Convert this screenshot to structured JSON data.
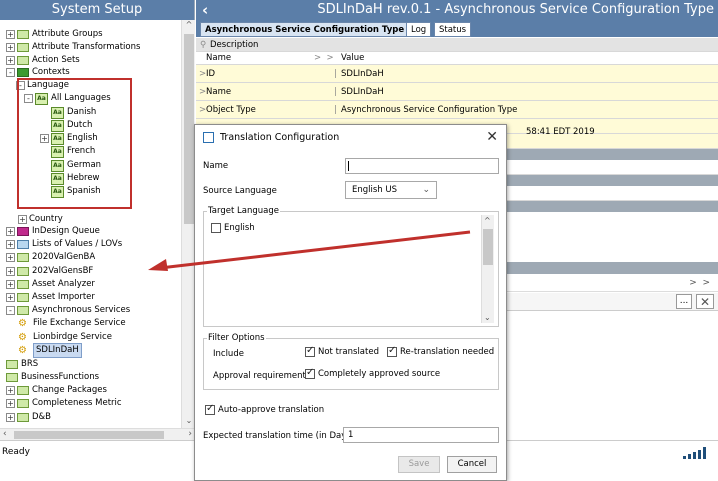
{
  "left_panel": {
    "title": "System Setup",
    "tree": [
      {
        "label": "Attribute Groups",
        "exp": "+",
        "icon": "folder"
      },
      {
        "label": "Attribute Transformations",
        "exp": "+",
        "icon": "folder"
      },
      {
        "label": "Action Sets",
        "exp": "+",
        "icon": "folder"
      },
      {
        "label": "Contexts",
        "exp": "-",
        "icon": "folder-green"
      },
      {
        "label": "Language",
        "exp": "-",
        "icon": "none"
      },
      {
        "label": "All Languages",
        "exp": "-",
        "icon": "language"
      },
      {
        "label": "Danish",
        "exp": "",
        "icon": "language"
      },
      {
        "label": "Dutch",
        "exp": "",
        "icon": "language"
      },
      {
        "label": "English",
        "exp": "+",
        "icon": "language"
      },
      {
        "label": "French",
        "exp": "",
        "icon": "language"
      },
      {
        "label": "German",
        "exp": "",
        "icon": "language"
      },
      {
        "label": "Hebrew",
        "exp": "",
        "icon": "language"
      },
      {
        "label": "Spanish",
        "exp": "",
        "icon": "language"
      },
      {
        "label": "Country",
        "exp": "+",
        "icon": "none"
      },
      {
        "label": "InDesign Queue",
        "exp": "+",
        "icon": "indesign"
      },
      {
        "label": "Lists of Values / LOVs",
        "exp": "+",
        "icon": "lov"
      },
      {
        "label": "2020ValGenBA",
        "exp": "+",
        "icon": "folder"
      },
      {
        "label": "202ValGensBF",
        "exp": "+",
        "icon": "folder"
      },
      {
        "label": "Asset Analyzer",
        "exp": "+",
        "icon": "folder"
      },
      {
        "label": "Asset Importer",
        "exp": "+",
        "icon": "folder"
      },
      {
        "label": "Asynchronous Services",
        "exp": "-",
        "icon": "folder"
      },
      {
        "label": "File Exchange Service",
        "exp": "",
        "icon": "gear"
      },
      {
        "label": "Lionbirdge Service",
        "exp": "",
        "icon": "gear"
      },
      {
        "label": "SDLInDaH",
        "exp": "",
        "icon": "gear"
      },
      {
        "label": "BRS",
        "exp": "",
        "icon": "folder"
      },
      {
        "label": "BusinessFunctions",
        "exp": "",
        "icon": "folder"
      },
      {
        "label": "Change Packages",
        "exp": "+",
        "icon": "folder"
      },
      {
        "label": "Completeness Metric",
        "exp": "+",
        "icon": "folder"
      },
      {
        "label": "D&B",
        "exp": "+",
        "icon": "folder"
      }
    ]
  },
  "status_bar": {
    "text": "Ready"
  },
  "right_panel": {
    "title": "SDLInDaH rev.0.1 - Asynchronous Service Configuration Type",
    "tabs": [
      {
        "label": "Asynchronous Service Configuration Type",
        "active": true
      },
      {
        "label": "Log",
        "active": false
      },
      {
        "label": "Status",
        "active": false
      }
    ],
    "grid": {
      "section": "Description",
      "col_name": "Name",
      "col_value": "Value",
      "rows": [
        {
          "name": "ID",
          "value": "SDLInDaH"
        },
        {
          "name": "Name",
          "value": "SDLInDaH"
        },
        {
          "name": "Object Type",
          "value": "Asynchronous Service Configuration Type"
        }
      ],
      "partial_timestamp": "58:41 EDT 2019"
    }
  },
  "dialog": {
    "title": "Translation Configuration",
    "name_label": "Name",
    "name_value": "",
    "source_language_label": "Source Language",
    "source_language_value": "English US",
    "target_language_label": "Target Language",
    "target_languages": [
      {
        "label": "English",
        "checked": false
      }
    ],
    "filter_options_label": "Filter Options",
    "include_label": "Include",
    "not_translated_label": "Not translated",
    "retranslation_label": "Re-translation needed",
    "approval_label": "Approval requirement",
    "completely_approved_label": "Completely approved source",
    "auto_approve_label": "Auto-approve translation",
    "expected_time_label": "Expected translation time (in Days)",
    "expected_time_value": "1",
    "save_label": "Save",
    "cancel_label": "Cancel",
    "annotation_color": "#c0302c"
  }
}
